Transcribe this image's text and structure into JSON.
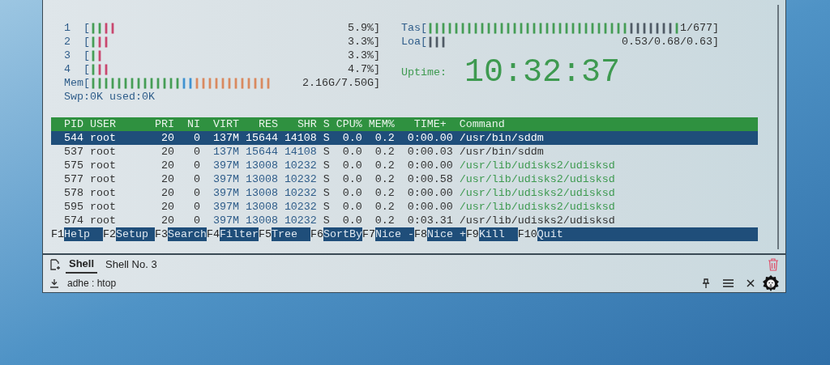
{
  "terminal": {
    "cpu_meters": [
      {
        "label": "1  [",
        "bars": [
          {
            "text": "||",
            "color": "#3f9a4f"
          },
          {
            "text": "||",
            "color": "#c8406a"
          }
        ],
        "reading": "5.9%]"
      },
      {
        "label": "2  [",
        "bars": [
          {
            "text": "|",
            "color": "#3f9a4f"
          },
          {
            "text": "||",
            "color": "#c8406a"
          }
        ],
        "reading": "3.3%]"
      },
      {
        "label": "3  [",
        "bars": [
          {
            "text": "|",
            "color": "#3f9a4f"
          },
          {
            "text": "|",
            "color": "#c8406a"
          }
        ],
        "reading": "3.3%]"
      },
      {
        "label": "4  [",
        "bars": [
          {
            "text": "|",
            "color": "#3f9a4f"
          },
          {
            "text": "||",
            "color": "#c8406a"
          }
        ],
        "reading": "4.7%]"
      }
    ],
    "memory": {
      "label": "Mem[",
      "bars": [
        {
          "text": "||||||||||||||",
          "color": "#3f9a4f"
        },
        {
          "text": "||",
          "color": "#3a8fd0"
        },
        {
          "text": "||||||||||||",
          "color": "#d9865a"
        }
      ],
      "reading": "2.16G/7.50G]"
    },
    "swap": "Swp:0K used:0K",
    "tasks": {
      "label": "Tas[",
      "bars": [
        {
          "text": "|||||||||||||||||||||||||||||||",
          "color": "#3f9a4f"
        },
        {
          "text": "|||||||",
          "color": "#4a5560"
        },
        {
          "text": "|",
          "color": "#3f9a4f"
        }
      ],
      "reading": "1/677]"
    },
    "load": {
      "label": "Loa[",
      "bars": [
        {
          "text": "|||",
          "color": "#4a5560"
        }
      ],
      "reading": "0.53/0.68/0.63]"
    },
    "uptime": {
      "label": "Uptime:",
      "value": "10:32:37"
    },
    "columns": [
      "PID",
      "USER",
      "PRI",
      "NI",
      "VIRT",
      "RES",
      "SHR",
      "S",
      "CPU%",
      "MEM%",
      "TIME+",
      "Command"
    ],
    "processes": [
      {
        "selected": true,
        "thread": false,
        "cells": [
          "544",
          "root",
          "20",
          "0",
          "137M",
          "15644",
          "14108",
          "S",
          "0.0",
          "0.2",
          "0:00.00",
          "/usr/bin/sddm"
        ]
      },
      {
        "selected": false,
        "thread": false,
        "cells": [
          "537",
          "root",
          "20",
          "0",
          "137M",
          "15644",
          "14108",
          "S",
          "0.0",
          "0.2",
          "0:00.03",
          "/usr/bin/sddm"
        ]
      },
      {
        "selected": false,
        "thread": true,
        "cells": [
          "575",
          "root",
          "20",
          "0",
          "397M",
          "13008",
          "10232",
          "S",
          "0.0",
          "0.2",
          "0:00.00",
          "/usr/lib/udisks2/udisksd"
        ]
      },
      {
        "selected": false,
        "thread": true,
        "cells": [
          "577",
          "root",
          "20",
          "0",
          "397M",
          "13008",
          "10232",
          "S",
          "0.0",
          "0.2",
          "0:00.58",
          "/usr/lib/udisks2/udisksd"
        ]
      },
      {
        "selected": false,
        "thread": true,
        "cells": [
          "578",
          "root",
          "20",
          "0",
          "397M",
          "13008",
          "10232",
          "S",
          "0.0",
          "0.2",
          "0:00.00",
          "/usr/lib/udisks2/udisksd"
        ]
      },
      {
        "selected": false,
        "thread": true,
        "cells": [
          "595",
          "root",
          "20",
          "0",
          "397M",
          "13008",
          "10232",
          "S",
          "0.0",
          "0.2",
          "0:00.00",
          "/usr/lib/udisks2/udisksd"
        ]
      },
      {
        "selected": false,
        "thread": false,
        "cells": [
          "574",
          "root",
          "20",
          "0",
          "397M",
          "13008",
          "10232",
          "S",
          "0.0",
          "0.2",
          "0:03.31",
          "/usr/lib/udisks2/udisksd"
        ]
      }
    ],
    "function_keys": [
      {
        "key": "F1",
        "label": "Help"
      },
      {
        "key": "F2",
        "label": "Setup"
      },
      {
        "key": "F3",
        "label": "Search"
      },
      {
        "key": "F4",
        "label": "Filter"
      },
      {
        "key": "F5",
        "label": "Tree"
      },
      {
        "key": "F6",
        "label": "SortBy"
      },
      {
        "key": "F7",
        "label": "Nice -"
      },
      {
        "key": "F8",
        "label": "Nice +"
      },
      {
        "key": "F9",
        "label": "Kill"
      },
      {
        "key": "F10",
        "label": "Quit"
      }
    ]
  },
  "tabs": [
    {
      "label": "Shell",
      "selected": true
    },
    {
      "label": "Shell No. 3",
      "selected": false
    }
  ],
  "status": "adhe : htop"
}
